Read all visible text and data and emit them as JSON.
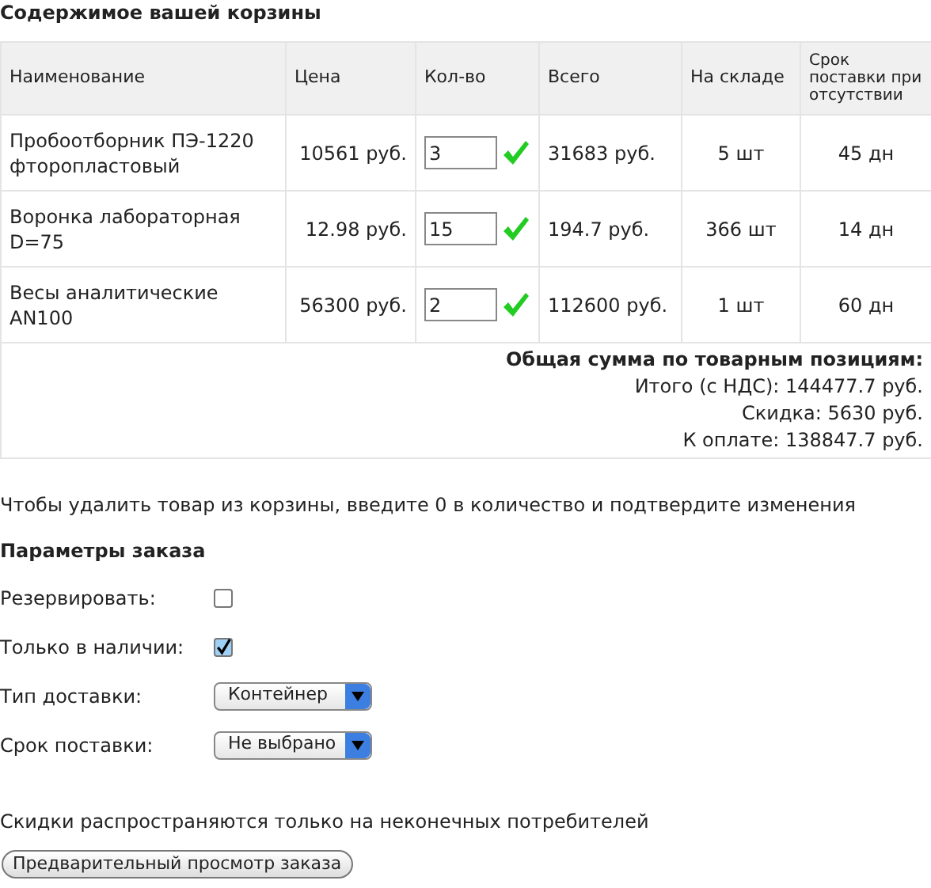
{
  "cart_title": "Содержимое вашей корзины",
  "table": {
    "columns": [
      "Наименование",
      "Цена",
      "Кол-во",
      "Всего",
      "На складе",
      "Срок поставки при отсутствии"
    ],
    "rows": [
      {
        "name": "Пробоотборник ПЭ-1220 фторопластовый",
        "price": "10561 руб.",
        "quantity": "3",
        "total": "31683 руб.",
        "stock": "5 шт",
        "delivery": "45 дн"
      },
      {
        "name": "Воронка лабораторная D=75",
        "price": "12.98 руб.",
        "quantity": "15",
        "total": "194.7 руб.",
        "stock": "366 шт",
        "delivery": "14 дн"
      },
      {
        "name": "Весы аналитические AN100",
        "price": "56300 руб.",
        "quantity": "2",
        "total": "112600 руб.",
        "stock": "1 шт",
        "delivery": "60 дн"
      }
    ],
    "summary": {
      "title": "Общая сумма по товарным позициям:",
      "lines": [
        "Итого (с НДС): 144477.7 руб.",
        "Скидка: 5630 руб.",
        "К оплате: 138847.7 руб."
      ]
    }
  },
  "remove_hint": "Чтобы удалить товар из корзины, введите 0 в количество и подтвердите изменения",
  "order_params": {
    "title": "Параметры заказа",
    "fields": [
      {
        "kind": "checkbox",
        "label": "Резервировать:",
        "checked": false
      },
      {
        "kind": "checkbox",
        "label": "Только в наличии:",
        "checked": true
      },
      {
        "kind": "select",
        "label": "Тип доставки:",
        "value": "Контейнер"
      },
      {
        "kind": "select",
        "label": "Срок поставки:",
        "value": "Не выбрано"
      }
    ]
  },
  "discount_note": "Скидки распространяются только на неконечных потребителей",
  "preview_button": "Предварительный просмотр заказа"
}
